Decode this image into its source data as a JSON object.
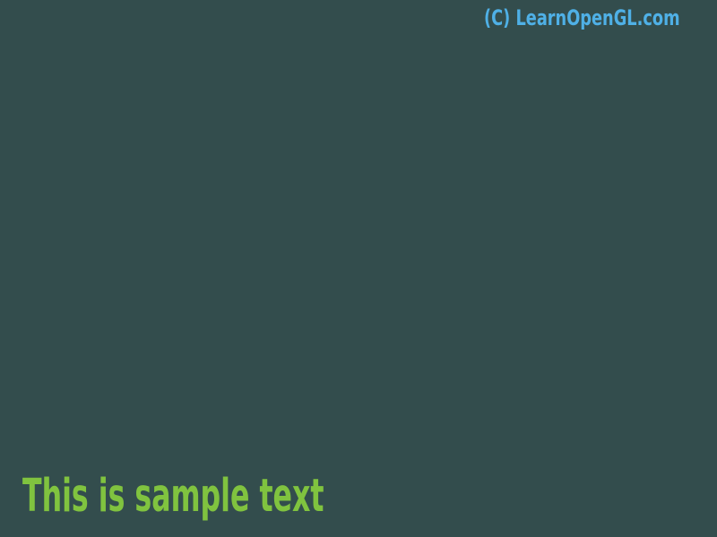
{
  "window": {
    "background_color": "#334d4d"
  },
  "overlay": {
    "credit_text": "(C) LearnOpenGL.com",
    "credit_color": "#4fb0e6",
    "sample_text": "This is sample text",
    "sample_color": "#80c33f"
  }
}
